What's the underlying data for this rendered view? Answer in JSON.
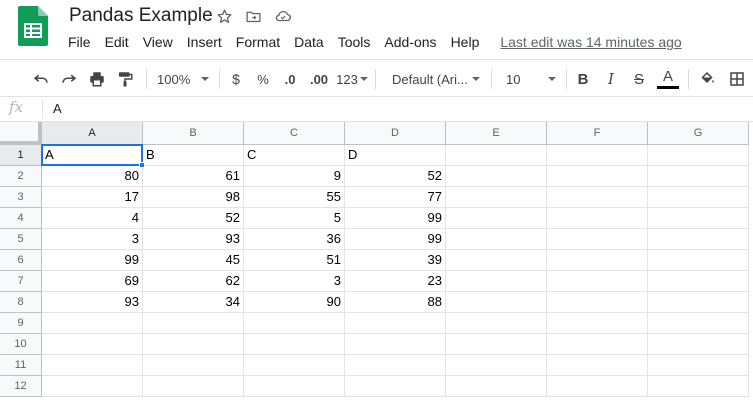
{
  "app": {
    "title": "Pandas Example",
    "last_edit": "Last edit was 14 minutes ago",
    "accent": "#0f9d58"
  },
  "menu": [
    "File",
    "Edit",
    "View",
    "Insert",
    "Format",
    "Data",
    "Tools",
    "Add-ons",
    "Help"
  ],
  "toolbar": {
    "zoom": "100%",
    "currency": "$",
    "percent": "%",
    "decrease_decimal": ".0",
    "increase_decimal": ".00",
    "more_formats": "123",
    "font": "Default (Ari...",
    "font_size": "10",
    "bold": "B",
    "italic": "I",
    "strike": "S",
    "text_color": "A"
  },
  "formula_bar": {
    "fx": "fx",
    "content": "A"
  },
  "sheet": {
    "columns": [
      "A",
      "B",
      "C",
      "D",
      "E",
      "F",
      "G"
    ],
    "rows": [
      "1",
      "2",
      "3",
      "4",
      "5",
      "6",
      "7",
      "8",
      "9",
      "10",
      "11",
      "12"
    ],
    "cells": [
      [
        "A",
        "B",
        "C",
        "D"
      ],
      [
        "80",
        "61",
        "9",
        "52"
      ],
      [
        "17",
        "98",
        "55",
        "77"
      ],
      [
        "4",
        "52",
        "5",
        "99"
      ],
      [
        "3",
        "93",
        "36",
        "99"
      ],
      [
        "99",
        "45",
        "51",
        "39"
      ],
      [
        "69",
        "62",
        "3",
        "23"
      ],
      [
        "93",
        "34",
        "90",
        "88"
      ]
    ],
    "selected_cell": "A1"
  }
}
